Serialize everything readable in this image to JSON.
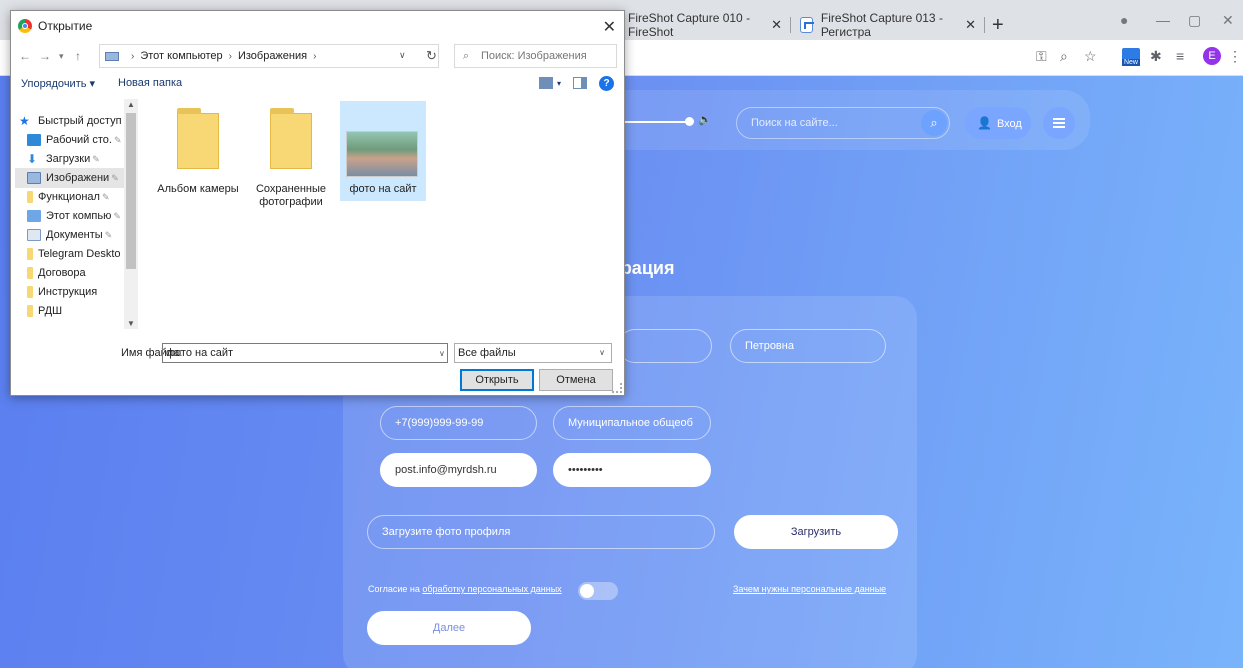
{
  "browser": {
    "tabs": [
      {
        "label": "FireShot Capture 010 - FireShot"
      },
      {
        "label": "FireShot Capture 013 - Регистра"
      }
    ],
    "profile_initial": "E",
    "new_ext_label": "New"
  },
  "dialog": {
    "title": "Открытие",
    "breadcrumb": [
      "Этот компьютер",
      "Изображения"
    ],
    "search_placeholder": "Поиск: Изображения",
    "organize_label": "Упорядочить ▾",
    "new_folder_label": "Новая папка",
    "nav_items": [
      {
        "label": "Быстрый доступ"
      },
      {
        "label": "Рабочий сто."
      },
      {
        "label": "Загрузки"
      },
      {
        "label": "Изображени"
      },
      {
        "label": "Функционал"
      },
      {
        "label": "Этот компью"
      },
      {
        "label": "Документы"
      },
      {
        "label": "Telegram Deskto"
      },
      {
        "label": "Договора"
      },
      {
        "label": "Инструкция"
      },
      {
        "label": "РДШ"
      }
    ],
    "files": [
      {
        "label": "Альбом камеры"
      },
      {
        "label": "Сохраненные фотографии"
      },
      {
        "label": "фото на сайт"
      }
    ],
    "filename_label": "Имя файла:",
    "filename_value": "фото на сайт",
    "filetype_value": "Все файлы",
    "open_label": "Открыть",
    "cancel_label": "Отмена"
  },
  "site": {
    "search_placeholder": "Поиск на сайте...",
    "login_label": "Вход",
    "page_title": "трация",
    "fields": {
      "patronymic": "Петровна",
      "phone": "+7(999)999-99-99",
      "org": "Муниципальное общеоб",
      "email": "post.info@myrdsh.ru",
      "password": "•••••••••",
      "photo_placeholder": "Загрузите фото профиля"
    },
    "upload_label": "Загрузить",
    "consent_prefix": "Согласие на",
    "consent_link": "обработку персональных данных",
    "why_link": "Зачем нужны персональные данные",
    "next_label": "Далее"
  },
  "colors": {
    "accent": "#1a73e8",
    "page_gradient_start": "#5a7ef0",
    "page_gradient_end": "#79b4fb"
  }
}
